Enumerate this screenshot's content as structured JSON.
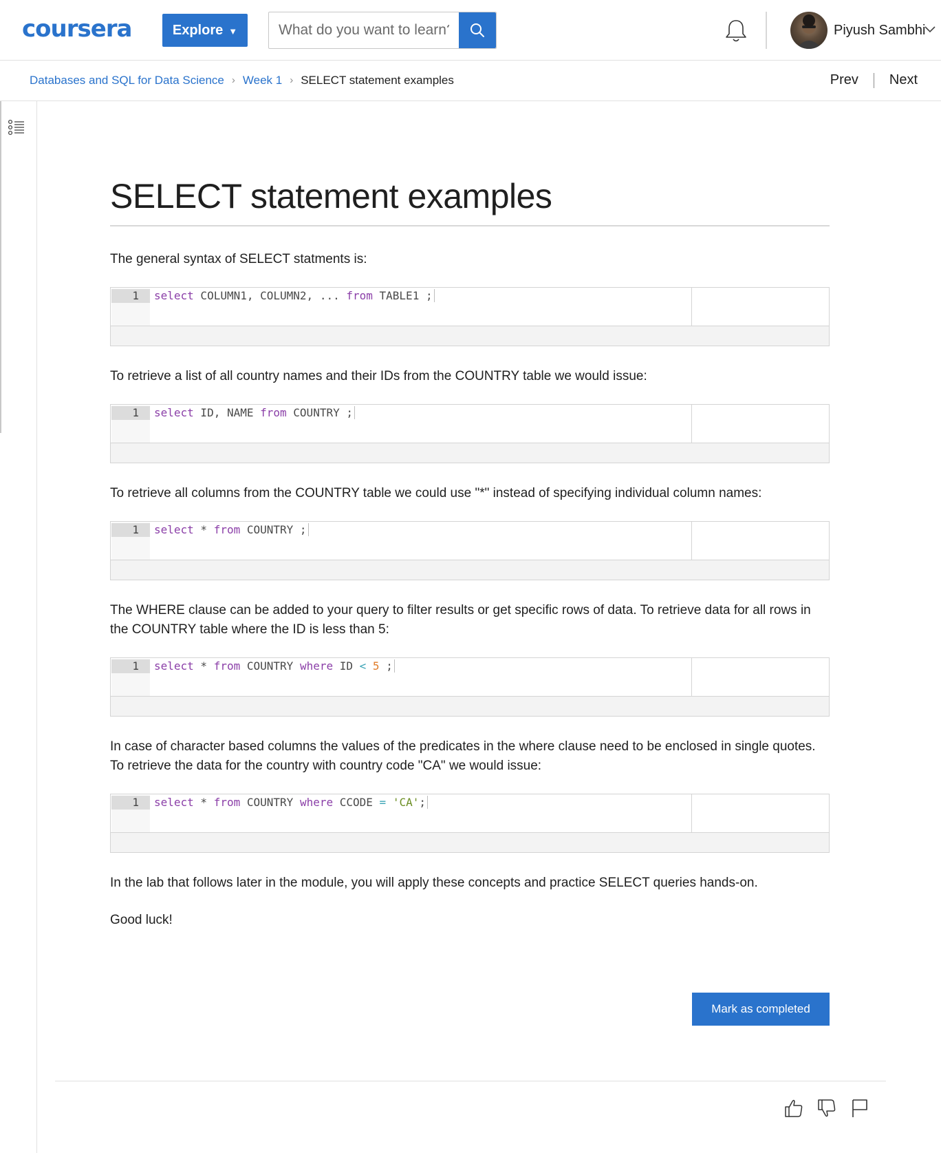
{
  "header": {
    "logo_text": "coursera",
    "explore_label": "Explore",
    "search_placeholder": "What do you want to learn?",
    "user_name": "Piyush Sambhi"
  },
  "breadcrumb": {
    "course": "Databases and SQL for Data Science",
    "week": "Week 1",
    "current": "SELECT statement examples",
    "prev_label": "Prev",
    "next_label": "Next"
  },
  "article": {
    "title": "SELECT statement examples",
    "p1": "The general syntax of SELECT statments is:",
    "p2": "To retrieve a list of all country names and their IDs from the COUNTRY table we would issue:",
    "p3": "To retrieve all columns from the COUNTRY table we could use \"*\" instead of specifying individual column names:",
    "p4": "The WHERE clause can be added to your query to filter results or get specific rows of data. To retrieve data for all rows in the COUNTRY table where the ID is less than 5:",
    "p5": "In case of character based columns the values of the predicates in the where clause need to be enclosed in single quotes. To retrieve the data for the country with country code \"CA\" we would issue:",
    "p6": "In the lab that follows later in the module, you will apply these concepts and practice SELECT queries hands-on.",
    "p7": "Good luck!",
    "line_number": "1",
    "code1": {
      "select": "select",
      "cols": " COLUMN1, COLUMN2, ... ",
      "from": "from",
      "rest": " TABLE1 ;"
    },
    "code2": {
      "select": "select",
      "cols": " ID, NAME ",
      "from": "from",
      "rest": " COUNTRY ;"
    },
    "code3": {
      "select": "select",
      "cols": " * ",
      "from": "from",
      "rest": " COUNTRY ;"
    },
    "code4": {
      "select": "select",
      "cols": " * ",
      "from": "from",
      "table": " COUNTRY ",
      "where": "where",
      "field": " ID ",
      "op": "<",
      "sp": " ",
      "val": "5",
      "end": " ;"
    },
    "code5": {
      "select": "select",
      "cols": " * ",
      "from": "from",
      "table": " COUNTRY ",
      "where": "where",
      "field": " CCODE ",
      "op": "=",
      "sp": " ",
      "val": "'CA'",
      "end": ";"
    },
    "mark_completed_label": "Mark as completed"
  },
  "icons": {
    "search": "search-icon",
    "notifications": "bell-icon",
    "outline": "list-outline-icon",
    "like": "thumbs-up-icon",
    "dislike": "thumbs-down-icon",
    "report": "flag-icon"
  },
  "colors": {
    "brand": "#2a73cc",
    "keyword": "#8b3fa8",
    "number": "#e07c29",
    "string": "#6b8e23",
    "operator": "#3aa3b5"
  }
}
